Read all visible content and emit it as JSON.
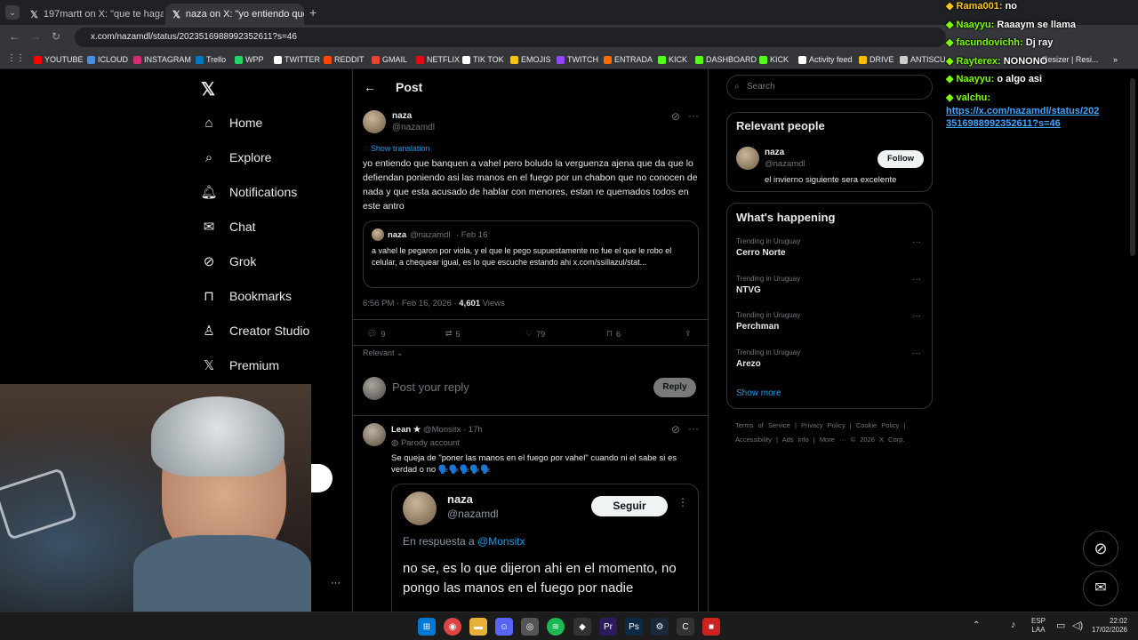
{
  "browser": {
    "tabs": [
      {
        "title": "197martt on X: \"que te haga m"
      },
      {
        "title": "naza on X: \"yo entiendo que ba"
      }
    ],
    "url": "x.com/nazamdl/status/2023516988992352611?s=46",
    "bookmarks": [
      "YOUTUBE",
      "ICLOUD",
      "INSTAGRAM",
      "Trello",
      "WPP",
      "TWITTER",
      "REDDIT",
      "GMAIL",
      "NETFLIX",
      "TIK TOK",
      "EMOJIS",
      "TWITCH",
      "ENTRADA",
      "KICK",
      "DASHBOARD",
      "KICK",
      "Activity feed",
      "DRIVE",
      "ANTISCU"
    ]
  },
  "sidebar": {
    "items": [
      "Home",
      "Explore",
      "Notifications",
      "Chat",
      "Grok",
      "Bookmarks",
      "Creator Studio",
      "Premium"
    ]
  },
  "post": {
    "header": "Post",
    "author_name": "naza",
    "author_handle": "@nazamdl",
    "show_translation": "Show translation",
    "text": "yo entiendo que banquen a vahel pero boludo la verguenza ajena que da que lo defiendan poniendo asi las manos en el fuego por un chabon que no conocen de nada y que esta acusado de hablar con menores, estan re quemados todos en este antro",
    "quote": {
      "name": "naza",
      "handle": "@nazamdl",
      "date": "· Feb 16",
      "text": "a vahel le pegaron por viola, y el que le pego supuestamente no fue el que le robo el celular, a chequear igual, es lo que escuche estando ahi x.com/ssillazul/stat..."
    },
    "time": "6:56 PM · Feb 16, 2026 ·",
    "views_count": "4,601",
    "views_label": "Views",
    "stats": {
      "replies": "9",
      "reposts": "5",
      "likes": "79",
      "bookmarks": "6"
    },
    "sort": "Relevant",
    "reply_placeholder": "Post your reply",
    "reply_button": "Reply"
  },
  "reply": {
    "name": "Lean ★",
    "handle": "@Monsitx",
    "time": "· 17h",
    "badge": "Parody account",
    "text": "Se queja de \"poner las manos en el fuego por vahel\" cuando ni el sabe si es verdad o no 🗣️🗣️🗣️🗣️🗣️",
    "embed": {
      "name": "naza",
      "handle": "@nazamdl",
      "follow": "Seguir",
      "in_reply": "En respuesta a",
      "in_reply_handle": "@Monsitx",
      "text": "no se, es lo que dijeron ahi en el momento, no pongo las manos en el fuego por nadie"
    }
  },
  "right": {
    "search_placeholder": "Search",
    "relevant_title": "Relevant people",
    "person": {
      "name": "naza",
      "handle": "@nazamdl",
      "bio": "el invierno siguiente sera excelente",
      "follow": "Follow"
    },
    "happening_title": "What's happening",
    "trends": [
      {
        "ctx": "Trending in Uruguay",
        "name": "Cerro Norte"
      },
      {
        "ctx": "Trending in Uruguay",
        "name": "NTVG"
      },
      {
        "ctx": "Trending in Uruguay",
        "name": "Perchman"
      },
      {
        "ctx": "Trending in Uruguay",
        "name": "Arezo"
      }
    ],
    "show_more": "Show more",
    "footer1": [
      "Terms of Service",
      "|",
      "Privacy Policy",
      "|",
      "Cookie Policy",
      "|"
    ],
    "footer2": [
      "Accessibility",
      "|",
      "Ads info",
      "|",
      "More ···",
      "© 2026 X Corp."
    ]
  },
  "chat": [
    {
      "user": "Rama001:",
      "msg": "no",
      "color": "#f5c518"
    },
    {
      "user": "Naayyu:",
      "msg": "Raaaym se llama",
      "color": "#7cfc00"
    },
    {
      "user": "facundovichh:",
      "msg": "Dj ray",
      "color": "#7cfc00"
    },
    {
      "user": "Rayterex:",
      "msg": "NONONO",
      "color": "#7cfc00"
    },
    {
      "user": "Naayyu:",
      "msg": "o algo asi",
      "color": "#7cfc00"
    },
    {
      "user": "valchu:",
      "msg": "",
      "color": "#7cfc00"
    }
  ],
  "chat_link": [
    "https://x.com/nazamdl/status/202",
    "3516988992352611?s=46"
  ],
  "tray": {
    "lang1": "ESP",
    "lang2": "LAA",
    "time": "22:02",
    "date": "17/02/2026"
  },
  "colors": {
    "accent": "#1d9bf0",
    "bg": "#000000",
    "border": "#2f3336"
  }
}
